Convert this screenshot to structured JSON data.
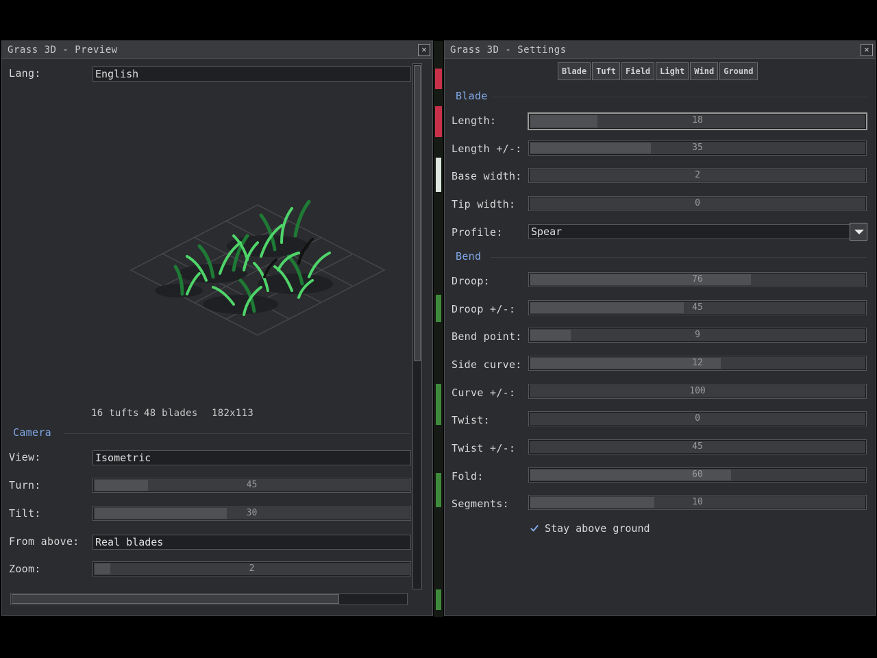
{
  "preview": {
    "title": "Grass 3D - Preview",
    "lang_label": "Lang:",
    "lang_value": "English",
    "status": {
      "tufts": "16 tufts",
      "blades": "48 blades",
      "size": "182x113"
    },
    "camera": {
      "section": "Camera",
      "view_label": "View:",
      "view_value": "Isometric",
      "turn_label": "Turn:",
      "turn_value": "45",
      "turn_fraction": 0.17,
      "tilt_label": "Tilt:",
      "tilt_value": "30",
      "tilt_fraction": 0.42,
      "from_above_label": "From above:",
      "from_above_value": "Real blades",
      "zoom_label": "Zoom:",
      "zoom_value": "2",
      "zoom_fraction": 0.05
    },
    "close_icon": "close-icon"
  },
  "settings": {
    "title": "Grass 3D - Settings",
    "tabs": [
      "Blade",
      "Tuft",
      "Field",
      "Light",
      "Wind",
      "Ground"
    ],
    "blade": {
      "section": "Blade",
      "rows": [
        {
          "label": "Length:",
          "value": "18",
          "fraction": 0.2
        },
        {
          "label": "Length +/-:",
          "value": "35",
          "fraction": 0.36
        },
        {
          "label": "Base width:",
          "value": "2",
          "fraction": 0.0
        },
        {
          "label": "Tip width:",
          "value": "0",
          "fraction": 0.0
        }
      ],
      "profile_label": "Profile:",
      "profile_value": "Spear"
    },
    "bend": {
      "section": "Bend",
      "rows": [
        {
          "label": "Droop:",
          "value": "76",
          "fraction": 0.66
        },
        {
          "label": "Droop +/-:",
          "value": "45",
          "fraction": 0.46
        },
        {
          "label": "Bend point:",
          "value": "9",
          "fraction": 0.12
        },
        {
          "label": "Side curve:",
          "value": "12",
          "fraction": 0.57
        },
        {
          "label": "Curve +/-:",
          "value": "100",
          "fraction": 0.0
        },
        {
          "label": "Twist:",
          "value": "0",
          "fraction": 0.0
        },
        {
          "label": "Twist +/-:",
          "value": "45",
          "fraction": 0.0
        },
        {
          "label": "Fold:",
          "value": "60",
          "fraction": 0.6
        },
        {
          "label": "Segments:",
          "value": "10",
          "fraction": 0.37
        }
      ],
      "stay_above_ground": "Stay above ground"
    }
  },
  "colors": {
    "accent": "#7fa8e8",
    "grass_light": "#4fd46a",
    "grass_dark": "#1e7a35"
  }
}
